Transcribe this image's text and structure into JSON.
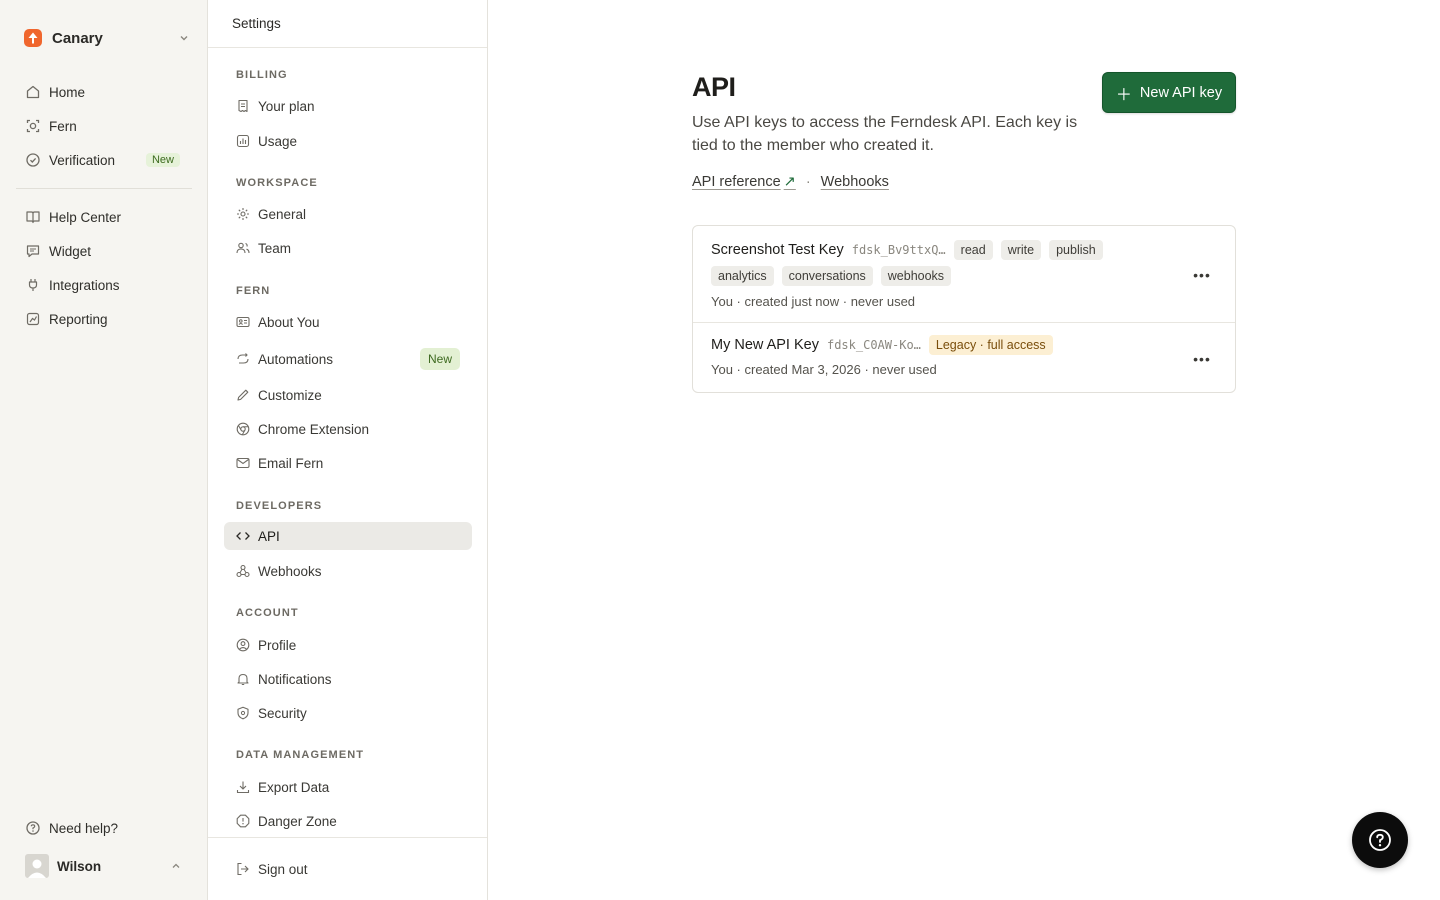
{
  "workspace": {
    "name": "Canary"
  },
  "primary_nav": {
    "items": [
      {
        "label": "Home",
        "icon": "home-icon"
      },
      {
        "label": "Fern",
        "icon": "fern-icon"
      },
      {
        "label": "Verification",
        "icon": "check-circle-icon",
        "badge": "New"
      },
      {
        "label": "Help Center",
        "icon": "book-icon"
      },
      {
        "label": "Widget",
        "icon": "chat-icon"
      },
      {
        "label": "Integrations",
        "icon": "plug-icon"
      },
      {
        "label": "Reporting",
        "icon": "chart-icon"
      }
    ],
    "need_help": "Need help?",
    "user": "Wilson"
  },
  "settings_nav": {
    "title": "Settings",
    "sections": {
      "billing": "BILLING",
      "workspace": "WORKSPACE",
      "fern": "FERN",
      "developers": "DEVELOPERS",
      "account": "ACCOUNT",
      "data_management": "DATA MANAGEMENT"
    },
    "items": {
      "your_plan": "Your plan",
      "usage": "Usage",
      "general": "General",
      "team": "Team",
      "about_you": "About You",
      "automations": "Automations",
      "automations_badge": "New",
      "customize": "Customize",
      "chrome_extension": "Chrome Extension",
      "email_fern": "Email Fern",
      "api": "API",
      "webhooks": "Webhooks",
      "profile": "Profile",
      "notifications": "Notifications",
      "security": "Security",
      "export_data": "Export Data",
      "danger_zone": "Danger Zone",
      "sign_out": "Sign out"
    },
    "active": "API"
  },
  "main": {
    "title": "API",
    "description": "Use API keys to access the Ferndesk API. Each key is tied to the member who created it.",
    "new_key_button": "New API key",
    "links": {
      "api_reference": "API reference",
      "ext_icon": "↗",
      "separator": "·",
      "webhooks": "Webhooks"
    },
    "keys": [
      {
        "name": "Screenshot Test Key",
        "prefix": "fdsk_Bv9ttxQ…",
        "scopes_line1": [
          "read",
          "write",
          "publish"
        ],
        "scopes_line2": [
          "analytics",
          "conversations",
          "webhooks"
        ],
        "meta": "You · created just now · never used"
      },
      {
        "name": "My New API Key",
        "prefix": "fdsk_C0AW-Ko…",
        "badge": "Legacy · full access",
        "meta": "You · created Mar 3, 2026 · never used"
      }
    ]
  },
  "colors": {
    "brand_green": "#1f6b3a",
    "logo_orange": "#f0662d",
    "sidebar_bg": "#f6f5f1",
    "legacy_badge_bg": "#fcefd3",
    "new_badge_bg": "#e3f0d3"
  }
}
